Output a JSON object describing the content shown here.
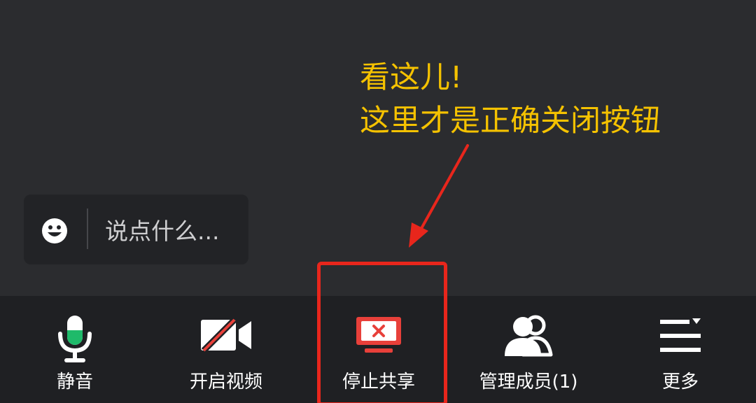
{
  "annotation": {
    "line1": "看这儿!",
    "line2": "这里才是正确关闭按钮",
    "color": "#f5c200",
    "highlight_color": "#e8261c"
  },
  "chat": {
    "placeholder": "说点什么...",
    "emoji_icon": "smiley-icon"
  },
  "toolbar": {
    "mute": {
      "label": "静音",
      "icon": "microphone-icon"
    },
    "video": {
      "label": "开启视频",
      "icon": "video-off-icon"
    },
    "share": {
      "label": "停止共享",
      "icon": "stop-screen-share-icon"
    },
    "members": {
      "label": "管理成员(1)",
      "icon": "members-icon"
    },
    "more": {
      "label": "更多",
      "icon": "more-menu-icon"
    }
  },
  "colors": {
    "background": "#2b2c2f",
    "toolbar": "#1f2023",
    "mic_active": "#1fba6a",
    "share_red": "#e8403a"
  }
}
